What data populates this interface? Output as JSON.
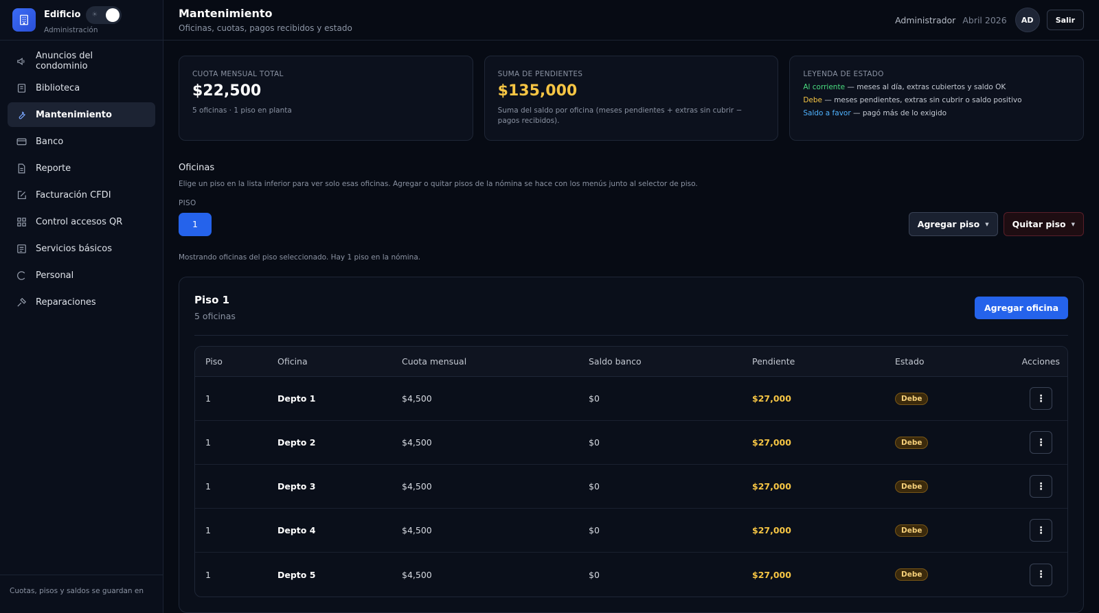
{
  "brand": {
    "name": "Edificio",
    "sub": "Administración",
    "toggle_icon": "sun-icon"
  },
  "sidebar": {
    "items": [
      {
        "label": "Anuncios del condominio",
        "icon": "megaphone-icon"
      },
      {
        "label": "Biblioteca",
        "icon": "book-icon"
      },
      {
        "label": "Mantenimiento",
        "icon": "wrench-icon",
        "active": true
      },
      {
        "label": "Banco",
        "icon": "bank-card-icon"
      },
      {
        "label": "Reporte",
        "icon": "document-icon"
      },
      {
        "label": "Facturación CFDI",
        "icon": "external-edit-icon"
      },
      {
        "label": "Control accesos QR",
        "icon": "qr-grid-icon"
      },
      {
        "label": "Servicios básicos",
        "icon": "list-icon"
      },
      {
        "label": "Personal",
        "icon": "spinner-icon"
      },
      {
        "label": "Reparaciones",
        "icon": "tools-icon"
      }
    ],
    "footer": "Cuotas, pisos y saldos se guardan en"
  },
  "header": {
    "title": "Mantenimiento",
    "subtitle": "Oficinas, cuotas, pagos recibidos y estado",
    "role": "Administrador",
    "month": "Abril 2026",
    "avatar": "AD",
    "logout": "Salir"
  },
  "cards": {
    "cuota": {
      "label": "CUOTA MENSUAL TOTAL",
      "value": "$22,500",
      "note": "5 oficinas · 1 piso en planta"
    },
    "pendientes": {
      "label": "SUMA DE PENDIENTES",
      "value": "$135,000",
      "note": "Suma del saldo por oficina (meses pendientes + extras sin cubrir − pagos recibidos)."
    },
    "leyenda": {
      "label": "LEYENDA DE ESTADO",
      "al_corriente": "Al corriente",
      "al_corriente_desc": " — meses al día, extras cubiertos y saldo OK",
      "debe": "Debe",
      "debe_desc": " — meses pendientes, extras sin cubrir o saldo positivo",
      "favor": "Saldo a favor",
      "favor_desc": " — pagó más de lo exigido"
    }
  },
  "oficinas": {
    "title": "Oficinas",
    "description": "Elige un piso en la lista inferior para ver solo esas oficinas. Agregar o quitar pisos de la nómina se hace con los menús junto al selector de piso.",
    "piso_label": "PISO",
    "piso_selected": "1",
    "add_floor": "Agregar piso",
    "remove_floor": "Quitar piso",
    "showing": "Mostrando oficinas del piso seleccionado. Hay 1 piso en la nómina."
  },
  "panel": {
    "title": "Piso 1",
    "subtitle": "5 oficinas",
    "add_office": "Agregar oficina"
  },
  "table": {
    "headers": [
      "Piso",
      "Oficina",
      "Cuota mensual",
      "Saldo banco",
      "Pendiente",
      "Estado",
      "Acciones"
    ],
    "rows": [
      {
        "piso": "1",
        "oficina": "Depto 1",
        "cuota": "$4,500",
        "saldo": "$0",
        "pendiente": "$27,000",
        "estado": "Debe"
      },
      {
        "piso": "1",
        "oficina": "Depto 2",
        "cuota": "$4,500",
        "saldo": "$0",
        "pendiente": "$27,000",
        "estado": "Debe"
      },
      {
        "piso": "1",
        "oficina": "Depto 3",
        "cuota": "$4,500",
        "saldo": "$0",
        "pendiente": "$27,000",
        "estado": "Debe"
      },
      {
        "piso": "1",
        "oficina": "Depto 4",
        "cuota": "$4,500",
        "saldo": "$0",
        "pendiente": "$27,000",
        "estado": "Debe"
      },
      {
        "piso": "1",
        "oficina": "Depto 5",
        "cuota": "$4,500",
        "saldo": "$0",
        "pendiente": "$27,000",
        "estado": "Debe"
      }
    ]
  },
  "colors": {
    "accent": "#2563eb",
    "warning": "#f6c544",
    "ok": "#4ade80",
    "info": "#4fb3ff"
  }
}
